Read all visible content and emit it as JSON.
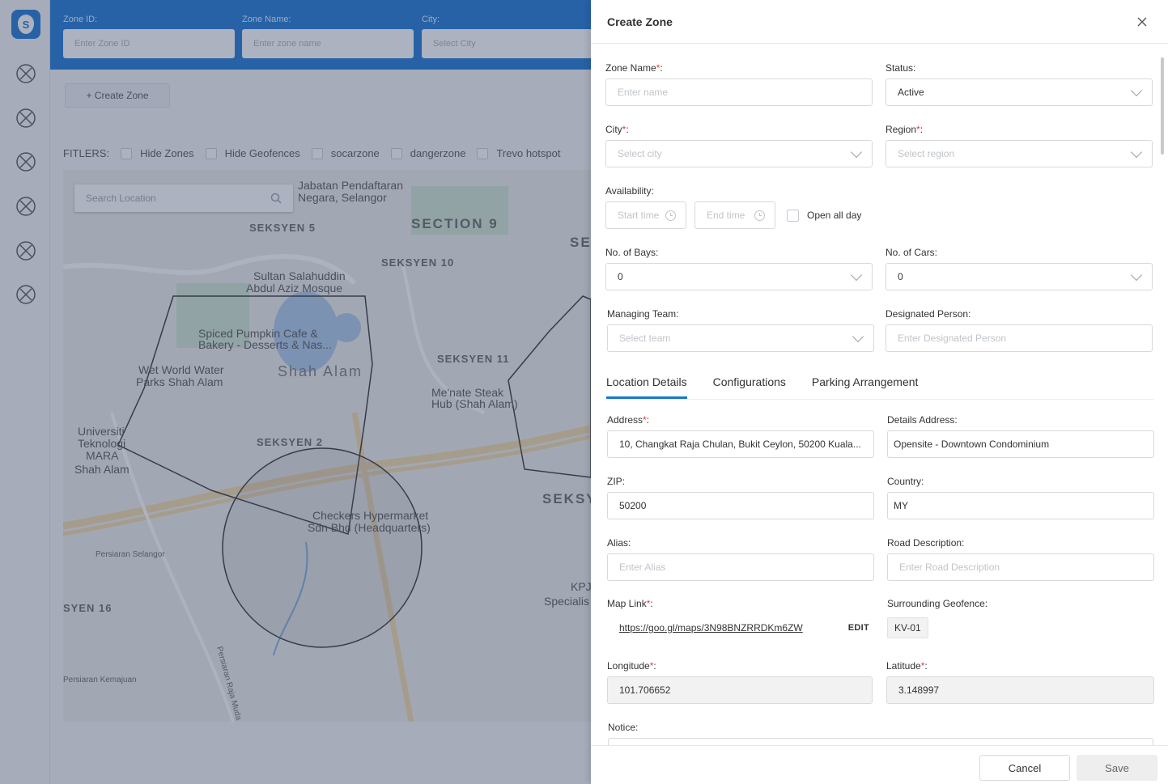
{
  "background": {
    "logo_letter": "S",
    "top_fields": [
      {
        "label": "Zone ID:",
        "placeholder": "Enter Zone ID"
      },
      {
        "label": "Zone Name:",
        "placeholder": "Enter zone name"
      },
      {
        "label": "City:",
        "placeholder": "Select City"
      }
    ],
    "create_zone_label": "+ Create Zone",
    "filters_label": "FITLERS:",
    "filters": [
      "Hide Zones",
      "Hide Geofences",
      "socarzone",
      "dangerzone",
      "Trevo hotspot"
    ],
    "map_search_placeholder": "Search Location",
    "map_labels": {
      "l1": "Jabatan Pendaftaran",
      "l2": "Negara, Selangor",
      "l3": "SEKSYEN 5",
      "l4": "SECTION 9",
      "l5": "SEKSYEN 10",
      "l6": "Sultan Salahuddin",
      "l7": "Abdul Aziz Mosque",
      "l8": "Spiced Pumpkin Cafe &",
      "l9": "Bakery - Desserts & Nas...",
      "l10": "Shah Alam",
      "l11": "Wet World Water",
      "l12": "Parks Shah Alam",
      "l13": "SEKSYEN 11",
      "l14": "Me'nate Steak",
      "l15": "Hub (Shah Alam)",
      "l16": "Universiti",
      "l17": "Teknologi",
      "l18": "MARA",
      "l19": "Shah Alam",
      "l20": "SEKSYEN 2",
      "l21": "Checkers Hypermarket",
      "l22": "Sdn Bhd (Headquarters)",
      "l23": "Persiaran Selangor",
      "l24": "SYEN 16",
      "l25": "SEKSY",
      "l26": "KPJ",
      "l27": "Specialis",
      "l28": "Persiaran Kemajuan",
      "l29": "Persiaran Raja Muda",
      "l30": "SE"
    }
  },
  "drawer": {
    "title": "Create Zone",
    "zone_name": {
      "label": "Zone Name",
      "placeholder": "Enter name"
    },
    "status": {
      "label": "Status:",
      "value": "Active"
    },
    "city": {
      "label": "City",
      "placeholder": "Select city"
    },
    "region": {
      "label": "Region",
      "placeholder": "Select region"
    },
    "availability": {
      "label": "Availability:",
      "start_placeholder": "Start time",
      "end_placeholder": "End time",
      "open_all_day": "Open all day"
    },
    "bays": {
      "label": "No. of Bays:",
      "value": "0"
    },
    "cars": {
      "label": "No. of Cars:",
      "value": "0"
    },
    "managing_team": {
      "label": "Managing Team:",
      "placeholder": "Select team"
    },
    "designated_person": {
      "label": "Designated Person:",
      "placeholder": "Enter Designated Person"
    },
    "tabs": [
      "Location Details",
      "Configurations",
      "Parking Arrangement"
    ],
    "address": {
      "label": "Address",
      "value": "10, Changkat Raja Chulan, Bukit Ceylon, 50200 Kuala..."
    },
    "details_address": {
      "label": "Details Address:",
      "value": "Opensite - Downtown Condominium"
    },
    "zip": {
      "label": "ZIP:",
      "value": "50200"
    },
    "country": {
      "label": "Country:",
      "value": "MY"
    },
    "alias": {
      "label": "Alias:",
      "placeholder": "Enter Alias"
    },
    "road_description": {
      "label": "Road Description:",
      "placeholder": "Enter Road Description"
    },
    "map_link": {
      "label": "Map Link",
      "value": "https://goo.gl/maps/3N98BNZRRDKm6ZW",
      "edit": "EDIT"
    },
    "surrounding_geofence": {
      "label": "Surrounding Geofence:",
      "value": "KV-01"
    },
    "longitude": {
      "label": "Longitude",
      "value": "101.706652"
    },
    "latitude": {
      "label": "Latitude",
      "value": "3.148997"
    },
    "notice": {
      "label": "Notice:"
    },
    "required_mark": "*",
    "colon": ":",
    "cancel": "Cancel",
    "save": "Save"
  },
  "colors": {
    "primary": "#1976d2",
    "required": "#e23c3c"
  }
}
